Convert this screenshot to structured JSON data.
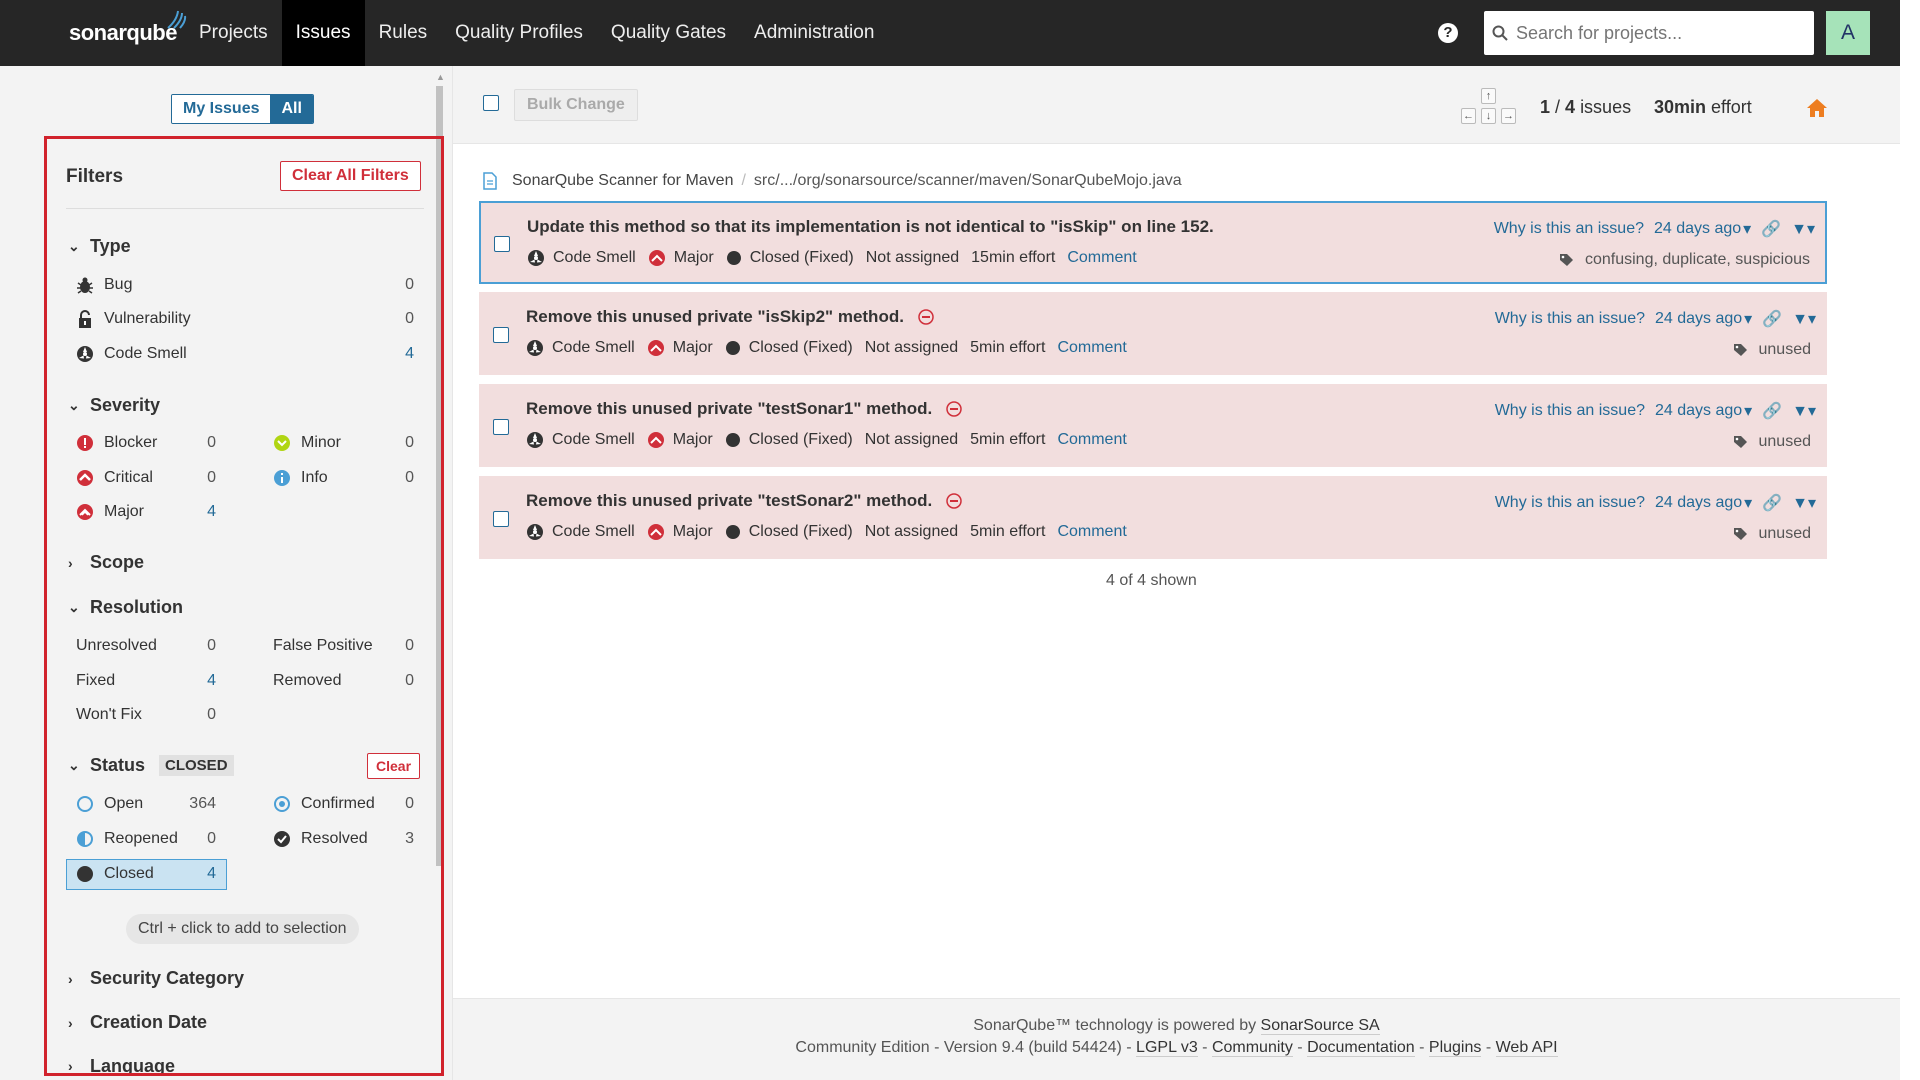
{
  "nav": {
    "logo": "sonarqube",
    "items": [
      "Projects",
      "Issues",
      "Rules",
      "Quality Profiles",
      "Quality Gates",
      "Administration"
    ],
    "search_placeholder": "Search for projects...",
    "avatar": "A",
    "help": "?"
  },
  "sidebar": {
    "my_issues": "My Issues",
    "all": "All",
    "filters_title": "Filters",
    "clear_all": "Clear All Filters",
    "type": {
      "title": "Type",
      "items": [
        {
          "label": "Bug",
          "count": "0"
        },
        {
          "label": "Vulnerability",
          "count": "0"
        },
        {
          "label": "Code Smell",
          "count": "4"
        }
      ]
    },
    "severity": {
      "title": "Severity",
      "items": [
        {
          "label": "Blocker",
          "count": "0"
        },
        {
          "label": "Minor",
          "count": "0"
        },
        {
          "label": "Critical",
          "count": "0"
        },
        {
          "label": "Info",
          "count": "0"
        },
        {
          "label": "Major",
          "count": "4"
        }
      ]
    },
    "scope": {
      "title": "Scope"
    },
    "resolution": {
      "title": "Resolution",
      "items": [
        {
          "label": "Unresolved",
          "count": "0"
        },
        {
          "label": "False Positive",
          "count": "0"
        },
        {
          "label": "Fixed",
          "count": "4"
        },
        {
          "label": "Removed",
          "count": "0"
        },
        {
          "label": "Won't Fix",
          "count": "0"
        }
      ]
    },
    "status": {
      "title": "Status",
      "tag": "CLOSED",
      "clear": "Clear",
      "items": [
        {
          "label": "Open",
          "count": "364"
        },
        {
          "label": "Confirmed",
          "count": "0"
        },
        {
          "label": "Reopened",
          "count": "0"
        },
        {
          "label": "Resolved",
          "count": "3"
        },
        {
          "label": "Closed",
          "count": "4"
        }
      ]
    },
    "hint": "Ctrl + click to add to selection",
    "security_category": "Security Category",
    "creation_date": "Creation Date",
    "language": "Language"
  },
  "toolbar": {
    "bulk_change": "Bulk Change",
    "count_current": "1",
    "count_total": "4",
    "count_label": "issues",
    "effort_value": "30min",
    "effort_label": "effort"
  },
  "component": {
    "project": "SonarQube Scanner for Maven",
    "path": "src/.../org/sonarsource/scanner/maven/SonarQubeMojo.java"
  },
  "issues": [
    {
      "title": "Update this method so that its implementation is not identical to \"isSkip\" on line 152.",
      "type": "Code Smell",
      "severity": "Major",
      "status": "Closed (Fixed)",
      "assignee": "Not assigned",
      "effort": "15min effort",
      "comment": "Comment",
      "why": "Why is this an issue?",
      "date": "24 days ago",
      "tags": "confusing, duplicate, suspicious"
    },
    {
      "title": "Remove this unused private \"isSkip2\" method.",
      "type": "Code Smell",
      "severity": "Major",
      "status": "Closed (Fixed)",
      "assignee": "Not assigned",
      "effort": "5min effort",
      "comment": "Comment",
      "why": "Why is this an issue?",
      "date": "24 days ago",
      "tags": "unused"
    },
    {
      "title": "Remove this unused private \"testSonar1\" method.",
      "type": "Code Smell",
      "severity": "Major",
      "status": "Closed (Fixed)",
      "assignee": "Not assigned",
      "effort": "5min effort",
      "comment": "Comment",
      "why": "Why is this an issue?",
      "date": "24 days ago",
      "tags": "unused"
    },
    {
      "title": "Remove this unused private \"testSonar2\" method.",
      "type": "Code Smell",
      "severity": "Major",
      "status": "Closed (Fixed)",
      "assignee": "Not assigned",
      "effort": "5min effort",
      "comment": "Comment",
      "why": "Why is this an issue?",
      "date": "24 days ago",
      "tags": "unused"
    }
  ],
  "shown": "4 of 4 shown",
  "footer": {
    "powered_prefix": "SonarQube™ technology is powered by",
    "powered_link": "SonarSource SA",
    "version": "Community Edition - Version 9.4 (build 54424) -",
    "links": [
      "LGPL v3",
      "Community",
      "Documentation",
      "Plugins",
      "Web API"
    ]
  },
  "colors": {
    "accent": "#236a97",
    "danger": "#d02f3a",
    "issue_bg": "#f2dede",
    "topnav": "#262626"
  }
}
